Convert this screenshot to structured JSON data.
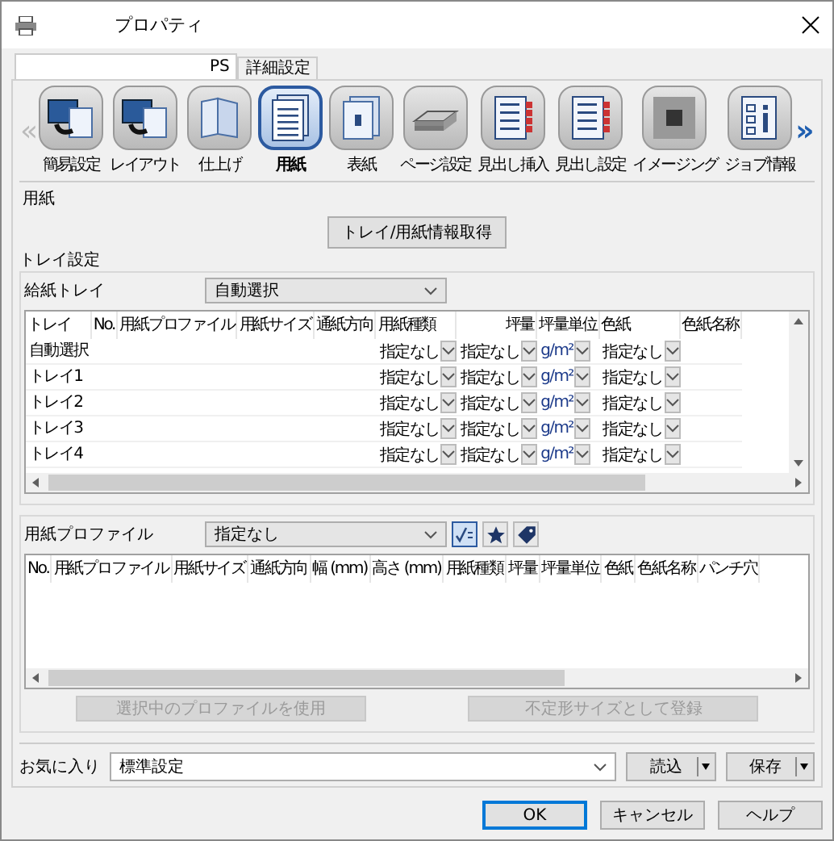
{
  "window": {
    "title": "プロパティ"
  },
  "tabs": [
    {
      "label": "PS",
      "selected": true
    },
    {
      "label": "詳細設定",
      "selected": false
    }
  ],
  "toolbar": {
    "prev": "«",
    "next": "»",
    "items": [
      {
        "label": "簡易設定",
        "selected": false
      },
      {
        "label": "レイアウト",
        "selected": false
      },
      {
        "label": "仕上げ",
        "selected": false
      },
      {
        "label": "用紙",
        "selected": true
      },
      {
        "label": "表紙",
        "selected": false
      },
      {
        "label": "ページ設定",
        "selected": false
      },
      {
        "label": "見出し挿入",
        "selected": false
      },
      {
        "label": "見出し設定",
        "selected": false
      },
      {
        "label": "イメージング",
        "selected": false
      },
      {
        "label": "ジョブ情報",
        "selected": false
      }
    ]
  },
  "paper": {
    "title": "用紙",
    "fetch_button": "トレイ/用紙情報取得",
    "tray_settings": {
      "title": "トレイ設定",
      "feed_tray_label": "給紙トレイ",
      "feed_tray_value": "自動選択",
      "columns": [
        "トレイ",
        "No.",
        "用紙プロファイル",
        "用紙サイズ",
        "通紙方向",
        "用紙種類",
        "坪量",
        "坪量単位",
        "色紙",
        "色紙名称"
      ],
      "rows": [
        {
          "tray": "自動選択",
          "paper_type": "指定なし",
          "weight": "指定なし",
          "weight_unit": "g/m²",
          "color_paper": "指定なし"
        },
        {
          "tray": "トレイ1",
          "paper_type": "指定なし",
          "weight": "指定なし",
          "weight_unit": "g/m²",
          "color_paper": "指定なし"
        },
        {
          "tray": "トレイ2",
          "paper_type": "指定なし",
          "weight": "指定なし",
          "weight_unit": "g/m²",
          "color_paper": "指定なし"
        },
        {
          "tray": "トレイ3",
          "paper_type": "指定なし",
          "weight": "指定なし",
          "weight_unit": "g/m²",
          "color_paper": "指定なし"
        },
        {
          "tray": "トレイ4",
          "paper_type": "指定なし",
          "weight": "指定なし",
          "weight_unit": "g/m²",
          "color_paper": "指定なし"
        }
      ]
    },
    "profile": {
      "label": "用紙プロファイル",
      "value": "指定なし",
      "toggles": [
        {
          "selected": true
        },
        {
          "selected": false
        },
        {
          "selected": false
        }
      ],
      "columns": [
        "No.",
        "用紙プロファイル",
        "用紙サイズ",
        "通紙方向",
        "幅 (mm)",
        "高さ (mm)",
        "用紙種類",
        "坪量",
        "坪量単位",
        "色紙",
        "色紙名称",
        "パンチ穴"
      ],
      "buttons": [
        {
          "label": "選択中のプロファイルを使用",
          "disabled": true
        },
        {
          "label": "不定形サイズとして登録",
          "disabled": true
        }
      ]
    }
  },
  "favorites": {
    "label": "お気に入り",
    "value": "標準設定",
    "buttons": [
      "読込",
      "保存"
    ]
  },
  "buttons": [
    {
      "label": "OK",
      "default": true
    },
    {
      "label": "キャンセル",
      "default": false
    },
    {
      "label": "ヘルプ",
      "default": false
    }
  ]
}
